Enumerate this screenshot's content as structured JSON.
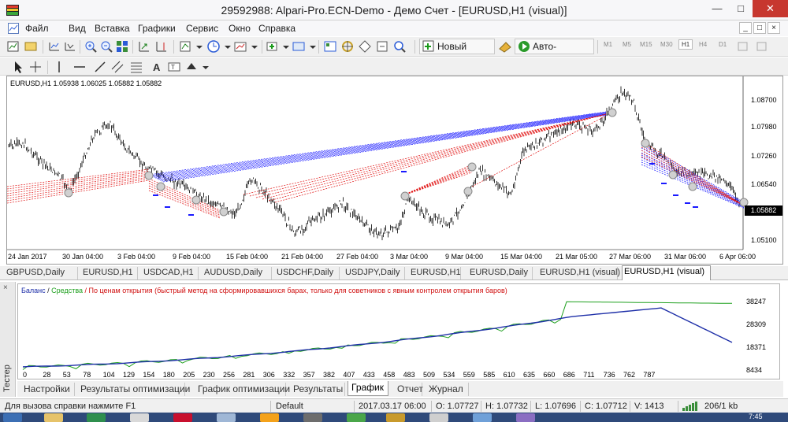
{
  "window": {
    "title": "29592988: Alpari-Pro.ECN-Demo - Демо Счет - [EURUSD,H1 (visual)]",
    "controls": {
      "minimize": "—",
      "maximize": "□",
      "close": "✕"
    }
  },
  "menu": {
    "items": [
      "Файл",
      "Вид",
      "Вставка",
      "Графики",
      "Сервис",
      "Окно",
      "Справка"
    ],
    "doc_controls": [
      "_",
      "□",
      "×"
    ]
  },
  "toolbar": {
    "new_order": "Новый ордер",
    "auto_trading": "Авто-торговля",
    "timeframes": [
      "M1",
      "M5",
      "M15",
      "M30",
      "H1",
      "H4",
      "D1"
    ],
    "active_timeframe": "H1"
  },
  "chart": {
    "info": "EURUSD,H1  1.05938 1.06025 1.05882 1.05882",
    "current_price": "1.05882",
    "price_labels": [
      "1.08700",
      "1.07980",
      "1.07260",
      "1.06540",
      "1.05100"
    ],
    "time_labels": [
      "24 Jan 2017",
      "30 Jan 04:00",
      "3 Feb 04:00",
      "9 Feb 04:00",
      "15 Feb 04:00",
      "21 Feb 04:00",
      "27 Feb 04:00",
      "3 Mar 04:00",
      "9 Mar 04:00",
      "15 Mar 04:00",
      "21 Mar 05:00",
      "27 Mar 06:00",
      "31 Mar 06:00",
      "6 Apr 06:00"
    ],
    "colors": {
      "candles": "#000000",
      "buy_lines": "#1a1aff",
      "sell_lines": "#e01010",
      "background": "#ffffff"
    }
  },
  "chart_tabs": {
    "items": [
      "GBPUSD,Daily",
      "EURUSD,H1",
      "USDCAD,H1",
      "AUDUSD,Daily",
      "USDCHF,Daily",
      "USDJPY,Daily",
      "EURUSD,H1",
      "EURUSD,Daily",
      "EURUSD,H1 (visual)",
      "EURUSD,H1 (visual)"
    ],
    "active_index": 9
  },
  "tester": {
    "side_label": "Тестер",
    "close": "×",
    "legend": {
      "balance": "Баланс",
      "separator": " / ",
      "equity": "Средства",
      "note": " / По ценам открытия (быстрый метод на сформировавшихся барах, только для советников с явным контролем открытия баров)"
    },
    "y_labels": [
      "38247",
      "28309",
      "18371",
      "8434"
    ],
    "x_labels": [
      "0",
      "28",
      "53",
      "78",
      "104",
      "129",
      "154",
      "180",
      "205",
      "230",
      "256",
      "281",
      "306",
      "332",
      "357",
      "382",
      "407",
      "433",
      "458",
      "483",
      "509",
      "534",
      "559",
      "585",
      "610",
      "635",
      "660",
      "686",
      "711",
      "736",
      "762",
      "787"
    ],
    "tabs": [
      "Настройки",
      "Результаты оптимизации",
      "График оптимизации",
      "Результаты",
      "График",
      "Отчет",
      "Журнал"
    ],
    "active_tab": "График",
    "colors": {
      "balance": "#1e2fa8",
      "equity": "#1fa01f",
      "note": "#d01010"
    }
  },
  "status": {
    "help": "Для вызова справки нажмите F1",
    "profile": "Default",
    "datetime": "2017.03.17 06:00",
    "open": "O: 1.07727",
    "high": "H: 1.07732",
    "low": "L: 1.07696",
    "close": "C: 1.07712",
    "volume": "V: 1413",
    "traffic": "206/1 kb"
  },
  "taskbar": {
    "clock": "7:45"
  }
}
